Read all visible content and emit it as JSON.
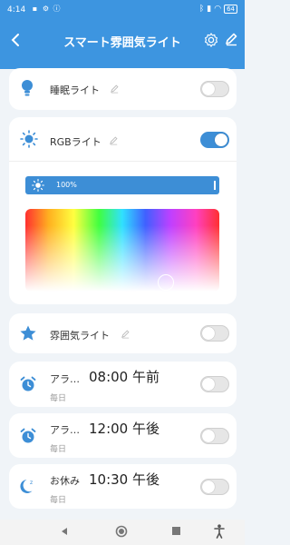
{
  "status_bar": {
    "time": "4:14",
    "battery": "64"
  },
  "header": {
    "title": "スマート雰囲気ライト"
  },
  "sleep_light": {
    "label": "睡眠ライト",
    "toggle_on": false
  },
  "rgb_light": {
    "label": "RGBライト",
    "toggle_on": true,
    "brightness_label": "100%",
    "brightness_value": 100
  },
  "ambient_light": {
    "label": "雰囲気ライト",
    "toggle_on": false
  },
  "alarms": [
    {
      "name": "アラ…",
      "time": "08:00 午前",
      "repeat": "毎日",
      "enabled": false
    },
    {
      "name": "アラ…",
      "time": "12:00 午後",
      "repeat": "毎日",
      "enabled": false
    },
    {
      "name": "お休み",
      "time": "10:30 午後",
      "repeat": "毎日",
      "enabled": false
    }
  ],
  "colors": {
    "header": "#3d95e0",
    "accent": "#3d8ed6",
    "background": "#f0f4f8"
  }
}
